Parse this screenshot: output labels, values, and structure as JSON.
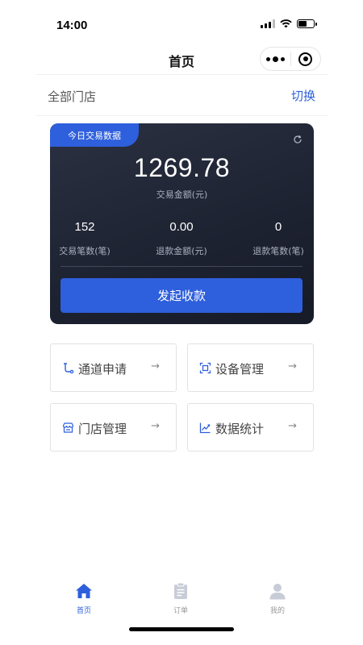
{
  "status_bar": {
    "time": "14:00"
  },
  "nav": {
    "title": "首页"
  },
  "store": {
    "name": "全部门店",
    "switch_label": "切换"
  },
  "stats": {
    "tag": "今日交易数据",
    "amount": "1269.78",
    "amount_label": "交易金额(元)",
    "items": [
      {
        "value": "152",
        "label": "交易笔数(笔)"
      },
      {
        "value": "0.00",
        "label": "退款金额(元)"
      },
      {
        "value": "0",
        "label": "退款笔数(笔)"
      }
    ],
    "button_label": "发起收款"
  },
  "menu": [
    {
      "label": "通道申请",
      "icon": "channel-icon",
      "arrow": "→"
    },
    {
      "label": "设备管理",
      "icon": "device-icon",
      "arrow": "→"
    },
    {
      "label": "门店管理",
      "icon": "store-icon",
      "arrow": "→"
    },
    {
      "label": "数据统计",
      "icon": "chart-icon",
      "arrow": "→"
    }
  ],
  "tabs": [
    {
      "label": "首页",
      "icon": "home-icon",
      "active": true
    },
    {
      "label": "订单",
      "icon": "clipboard-icon",
      "active": false
    },
    {
      "label": "我的",
      "icon": "user-icon",
      "active": false
    }
  ],
  "colors": {
    "accent": "#2e5fdc",
    "card_bg": "#1d2231",
    "inactive_tab": "#c8ccd6"
  }
}
